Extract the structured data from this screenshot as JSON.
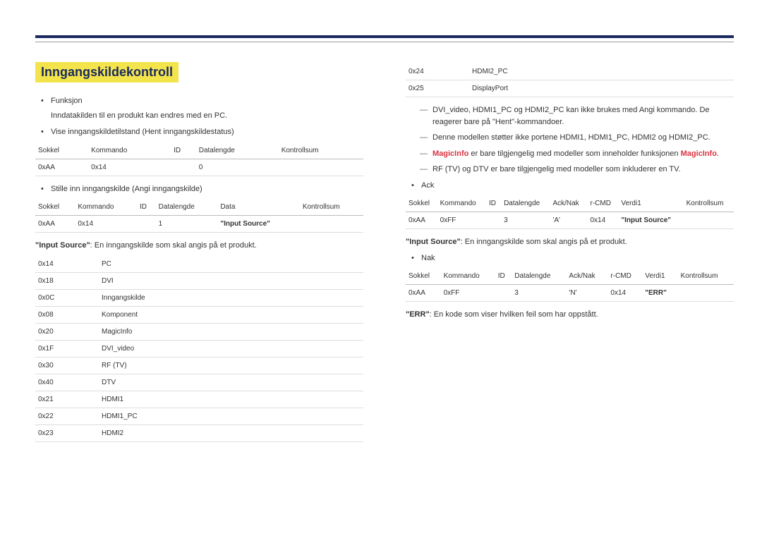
{
  "heading": "Inngangskildekontroll",
  "left": {
    "funksjon_label": "Funksjon",
    "funksjon_text": "Inndatakilden til en produkt kan endres med en PC.",
    "vise_label": "Vise inngangskildetilstand (Hent inngangskildestatus)",
    "table1_headers": [
      "Sokkel",
      "Kommando",
      "ID",
      "Datalengde",
      "Kontrollsum"
    ],
    "table1_row": [
      "0xAA",
      "0x14",
      "",
      "0",
      ""
    ],
    "stille_label": "Stille inn inngangskilde (Angi inngangskilde)",
    "table2_headers": [
      "Sokkel",
      "Kommando",
      "ID",
      "Datalengde",
      "Data",
      "Kontrollsum"
    ],
    "table2_row": [
      "0xAA",
      "0x14",
      "",
      "1",
      "\"Input Source\"",
      ""
    ],
    "desc1_label": "\"Input Source\"",
    "desc1_text": ": En inngangskilde som skal angis på et produkt.",
    "src_rows": [
      [
        "0x14",
        "PC"
      ],
      [
        "0x18",
        "DVI"
      ],
      [
        "0x0C",
        "Inngangskilde"
      ],
      [
        "0x08",
        "Komponent"
      ],
      [
        "0x20",
        "MagicInfo"
      ],
      [
        "0x1F",
        "DVI_video"
      ],
      [
        "0x30",
        "RF (TV)"
      ],
      [
        "0x40",
        "DTV"
      ],
      [
        "0x21",
        "HDMI1"
      ],
      [
        "0x22",
        "HDMI1_PC"
      ],
      [
        "0x23",
        "HDMI2"
      ]
    ]
  },
  "right": {
    "src_rows_cont": [
      [
        "0x24",
        "HDMI2_PC"
      ],
      [
        "0x25",
        "DisplayPort"
      ]
    ],
    "dash1": "DVI_video, HDMI1_PC og HDMI2_PC kan ikke brukes med Angi kommando. De reagerer bare på \"Hent\"-kommandoer.",
    "dash2": "Denne modellen støtter ikke portene HDMI1, HDMI1_PC, HDMI2 og HDMI2_PC.",
    "dash3_prefix": "MagicInfo",
    "dash3_mid": " er bare tilgjengelig med modeller som inneholder funksjonen ",
    "dash3_suffix": "MagicInfo",
    "dash3_end": ".",
    "dash4": "RF (TV) og DTV er bare tilgjengelig med modeller som inkluderer en TV.",
    "ack_label": "Ack",
    "ack_headers": [
      "Sokkel",
      "Kommando",
      "ID",
      "Datalengde",
      "Ack/Nak",
      "r-CMD",
      "Verdi1",
      "Kontrollsum"
    ],
    "ack_row": [
      "0xAA",
      "0xFF",
      "",
      "3",
      "'A'",
      "0x14",
      "\"Input Source\"",
      ""
    ],
    "desc2_label": "\"Input Source\"",
    "desc2_text": ": En inngangskilde som skal angis på et produkt.",
    "nak_label": "Nak",
    "nak_headers": [
      "Sokkel",
      "Kommando",
      "ID",
      "Datalengde",
      "Ack/Nak",
      "r-CMD",
      "Verdi1",
      "Kontrollsum"
    ],
    "nak_row": [
      "0xAA",
      "0xFF",
      "",
      "3",
      "'N'",
      "0x14",
      "\"ERR\"",
      ""
    ],
    "err_label": "\"ERR\"",
    "err_text": ": En kode som viser hvilken feil som har oppstått."
  }
}
